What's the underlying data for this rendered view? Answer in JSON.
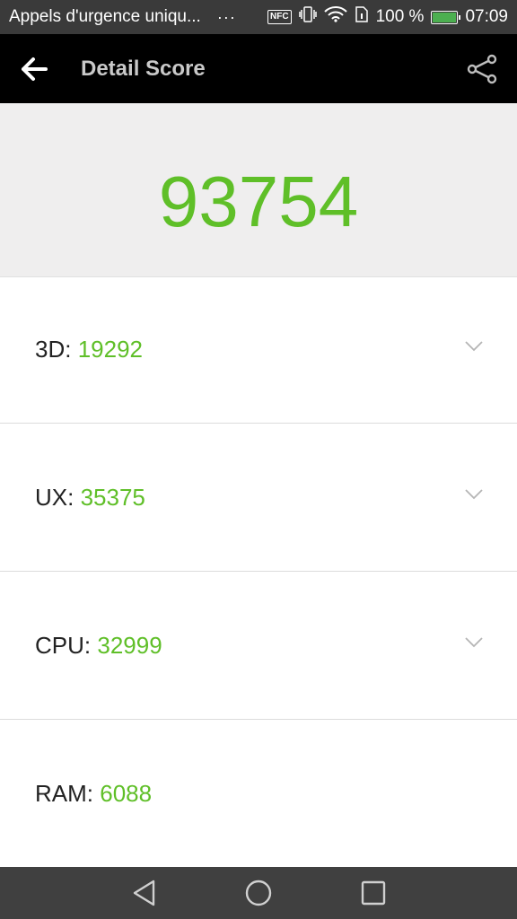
{
  "status_bar": {
    "carrier_text": "Appels d'urgence uniqu...",
    "dots": "···",
    "nfc": "NFC",
    "battery": "100 %",
    "time": "07:09"
  },
  "app_bar": {
    "title": "Detail Score"
  },
  "score": {
    "total": "93754"
  },
  "rows": [
    {
      "label": "3D:",
      "value": "19292"
    },
    {
      "label": "UX:",
      "value": "35375"
    },
    {
      "label": "CPU:",
      "value": "32999"
    },
    {
      "label": "RAM:",
      "value": "6088"
    }
  ],
  "colors": {
    "accent": "#5fbf28",
    "appbar": "#000000",
    "statusbar": "#3a3a3a"
  }
}
